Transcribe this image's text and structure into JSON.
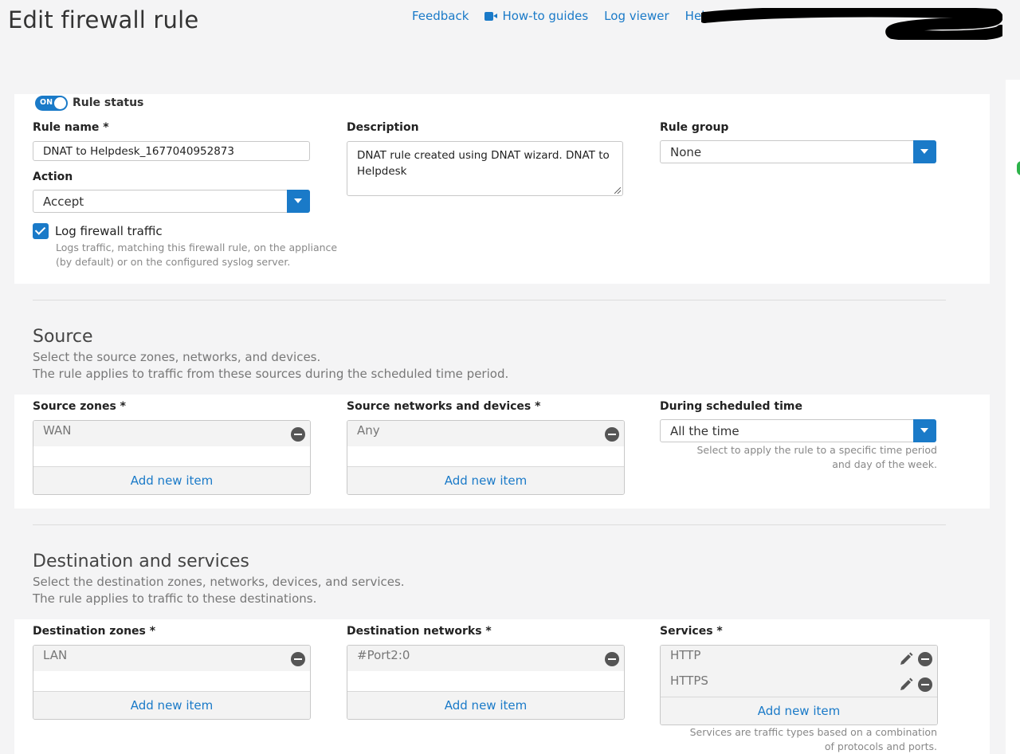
{
  "header": {
    "title": "Edit firewall rule",
    "links": {
      "feedback": "Feedback",
      "howto": "How-to guides",
      "logviewer": "Log viewer",
      "help": "Help"
    }
  },
  "rule": {
    "status_toggle": "ON",
    "status_label": "Rule status",
    "name_label": "Rule name *",
    "name_value": "DNAT to Helpdesk_1677040952873",
    "description_label": "Description",
    "description_value": "DNAT rule created using DNAT wizard. DNAT to Helpdesk",
    "group_label": "Rule group",
    "group_value": "None",
    "action_label": "Action",
    "action_value": "Accept",
    "log_label": "Log firewall traffic",
    "log_checked": true,
    "log_help": "Logs traffic, matching this firewall rule, on the appliance (by default) or on the configured syslog server."
  },
  "source": {
    "title": "Source",
    "desc1": "Select the source zones, networks, and devices.",
    "desc2": "The rule applies to traffic from these sources during the scheduled time period.",
    "zones_label": "Source zones *",
    "zones": [
      "WAN"
    ],
    "networks_label": "Source networks and devices *",
    "networks": [
      "Any"
    ],
    "schedule_label": "During scheduled time",
    "schedule_value": "All the time",
    "schedule_help": "Select to apply the rule to a specific time period and day of the week.",
    "add_label": "Add new item"
  },
  "destination": {
    "title": "Destination and services",
    "desc1": "Select the destination zones, networks, devices, and services.",
    "desc2": "The rule applies to traffic to these destinations.",
    "zones_label": "Destination zones *",
    "zones": [
      "LAN"
    ],
    "networks_label": "Destination networks *",
    "networks": [
      "#Port2:0"
    ],
    "services_label": "Services *",
    "services": [
      "HTTP",
      "HTTPS"
    ],
    "services_help": "Services are traffic types based on a combination of protocols and ports.",
    "add_label": "Add new item"
  },
  "colors": {
    "accent": "#1a7ac8",
    "status_green": "#2db34a"
  }
}
